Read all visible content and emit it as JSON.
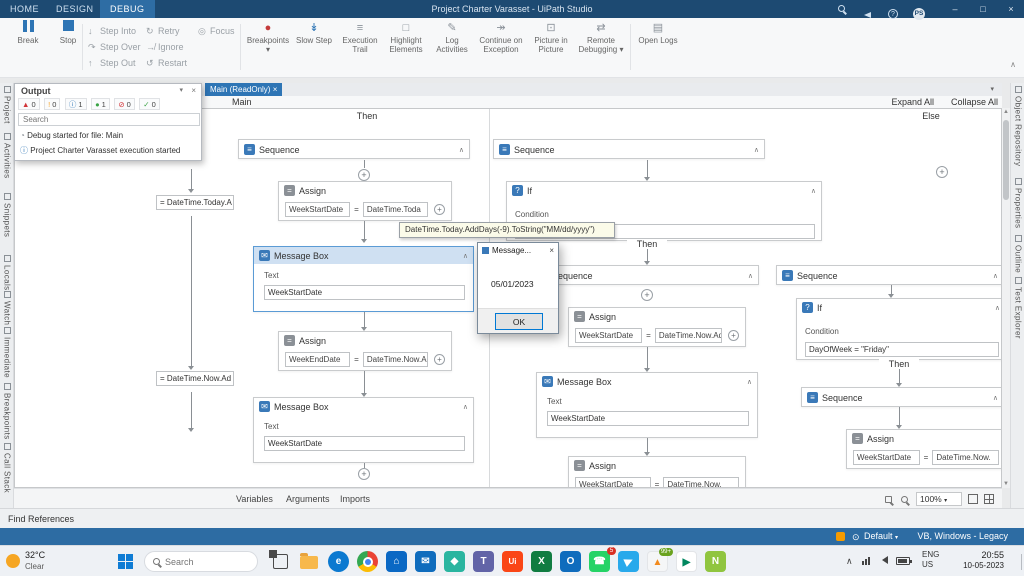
{
  "colors": {
    "titlebar": "#1d4a72",
    "accent": "#2e75b5",
    "statusbar": "#2d6ca3",
    "highlight_header": "#cfe0f2"
  },
  "titlebar": {
    "tabs": [
      "HOME",
      "DESIGN",
      "DEBUG"
    ],
    "title": "Project Charter Varasset - UiPath Studio",
    "avatar": "PS"
  },
  "ribbon": {
    "break_label": "Break",
    "stop_label": "Stop",
    "step_into": "Step Into",
    "step_over": "Step Over",
    "step_out": "Step Out",
    "retry": "Retry",
    "ignore": "Ignore",
    "restart": "Restart",
    "focus": "Focus",
    "breakpoints": "Breakpoints",
    "slow_step": "Slow Step",
    "execution_trail": "Execution Trail",
    "highlight_elements": "Highlight Elements",
    "log_activities": "Log Activities",
    "continue_on_exception": "Continue on Exception",
    "picture_in_picture": "Picture in Picture",
    "remote_debugging": "Remote Debugging",
    "open_logs": "Open Logs"
  },
  "left_tabs": [
    "Project",
    "Activities",
    "Snippets",
    "Locals",
    "Watch",
    "Immediate",
    "Breakpoints",
    "Call Stack"
  ],
  "right_tabs": [
    "Object Repository",
    "Properties",
    "Outline",
    "Test Explorer"
  ],
  "output": {
    "title": "Output",
    "search_placeholder": "Search",
    "badges": [
      {
        "name": "errors",
        "count": "0",
        "color": "#d13438"
      },
      {
        "name": "warnings",
        "count": "0",
        "color": "#f7a327"
      },
      {
        "name": "info",
        "count": "1",
        "color": "#2e75b5"
      },
      {
        "name": "trace",
        "count": "1",
        "color": "#3aa344"
      },
      {
        "name": "blocked",
        "count": "0",
        "color": "#d13438"
      },
      {
        "name": "success",
        "count": "0",
        "color": "#3aa344"
      }
    ],
    "messages": [
      "Debug started for file: Main",
      "Project Charter Varasset execution started"
    ]
  },
  "doc": {
    "tab_title": "Main (ReadOnly)",
    "breadcrumb": "Main",
    "expand_all": "Expand All",
    "collapse_all": "Collapse All"
  },
  "canvas": {
    "then1": "Then",
    "else1": "Else",
    "then2": "Then",
    "then3": "Then",
    "tooltip": "DateTime.Today.AddDays(-9).ToString(\"MM/dd/yyyy\")",
    "partial_assign_1": "= DateTime.Today.A",
    "partial_assign_2": "= DateTime.Now.Ad",
    "labels": {
      "sequence": "Sequence",
      "assign": "Assign",
      "message_box": "Message Box",
      "if": "If",
      "condition": "Condition",
      "text": "Text"
    },
    "assign1": {
      "to": "WeekStartDate",
      "value": "DateTime.Toda"
    },
    "msgbox1": {
      "text": "WeekStartDate"
    },
    "assign2": {
      "to": "WeekEndDate",
      "value": "DateTime.Now.Ad"
    },
    "msgbox2": {
      "text": "WeekStartDate"
    },
    "assign3": {
      "to": "WeekStartDate",
      "value": "DateTime.Now.Ad"
    },
    "msgbox3": {
      "text": "WeekStartDate"
    },
    "assign4": {
      "to": "WeekStartDate",
      "value": "DateTime.Now."
    },
    "if2_condition": "DayOfWeek = \"Friday\""
  },
  "dialog": {
    "title": "Message...",
    "body": "05/01/2023",
    "ok": "OK"
  },
  "designer_bar": {
    "tabs": [
      "Variables",
      "Arguments",
      "Imports"
    ],
    "zoom": "100%"
  },
  "find_references": "Find References",
  "statusbar": {
    "profile": "Default",
    "compat": "VB, Windows - Legacy"
  },
  "taskbar": {
    "weather_temp": "32°C",
    "weather_desc": "Clear",
    "search_placeholder": "Search",
    "apps": [
      {
        "name": "task-view",
        "glyph": "",
        "color": ""
      },
      {
        "name": "file-explorer",
        "glyph": "",
        "color": ""
      },
      {
        "name": "edge",
        "glyph": "e",
        "color": "#0b79d0"
      },
      {
        "name": "chrome",
        "glyph": "",
        "color": ""
      },
      {
        "name": "store",
        "glyph": "⌂",
        "color": "#0a68c4"
      },
      {
        "name": "mail",
        "glyph": "✉",
        "color": "#0f6cbd"
      },
      {
        "name": "photos",
        "glyph": "◆",
        "color": "#2ab5a0"
      },
      {
        "name": "teams",
        "glyph": "T",
        "color": "#6264a7"
      },
      {
        "name": "uipath",
        "glyph": "Ui",
        "color": "#fa4616"
      },
      {
        "name": "excel",
        "glyph": "X",
        "color": "#107c41"
      },
      {
        "name": "outlook",
        "glyph": "O",
        "color": "#0f6cbd"
      },
      {
        "name": "whatsapp",
        "glyph": "☎",
        "color": "#25d366",
        "badge": "5"
      },
      {
        "name": "telegram",
        "glyph": "▶",
        "color": "#29a9eb"
      },
      {
        "name": "vlc",
        "glyph": "▲",
        "color": "#f5f6f7",
        "badge": "99+"
      },
      {
        "name": "play-store",
        "glyph": "▶",
        "color": "#ffffff"
      },
      {
        "name": "notepad",
        "glyph": "N",
        "color": "#90c53f"
      }
    ],
    "lang_line1": "ENG",
    "lang_line2": "US",
    "time": "20:55",
    "date": "10-05-2023"
  }
}
